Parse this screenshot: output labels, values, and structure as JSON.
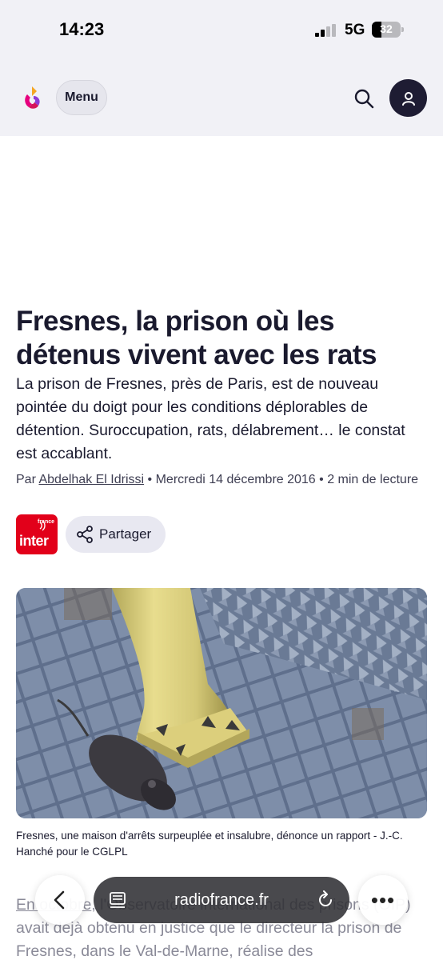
{
  "status_bar": {
    "time": "14:23",
    "network": "5G",
    "battery": "32"
  },
  "header": {
    "menu_label": "Menu",
    "logo_icon": "radiofrance-logo",
    "search_icon": "search-icon",
    "account_icon": "user-icon"
  },
  "article": {
    "title": "Fresnes, la prison où les détenus vivent avec les rats",
    "lead": "La prison de Fresnes, près de Paris, est de nouveau pointée du doigt pour les conditions déplorables de détention. Suroccupation, rats, délabrement… le constat est accablant.",
    "byline": {
      "prefix": "Par",
      "author": "Abdelhak El Idrissi",
      "date": "• Mercredi 14 décembre 2016",
      "reading_time": "• 2 min de lecture"
    },
    "station": {
      "small": "france",
      "name": "inter"
    },
    "share_label": "Partager",
    "caption": "Fresnes, une maison d'arrêts surpeuplée et insalubre, dénonce un rapport - J.-C. Hanché pour le CGLPL",
    "body": {
      "link": "En octobre",
      "text": ", l'Observatoire international des prisons (OIP) avait déjà obtenu en justice que le directeur la prison de Fresnes, dans le Val-de-Marne, réalise des"
    }
  },
  "browser": {
    "url": "radiofrance.fr",
    "back_icon": "chevron-left-icon",
    "reader_icon": "reader-icon",
    "reload_icon": "reload-icon",
    "more_label": "•••"
  },
  "colors": {
    "header_bg": "#f1f1f6",
    "text": "#1a1a2e",
    "account_bg": "#1e1c33",
    "inter_red": "#e2001a",
    "share_bg": "#e8e8f1"
  }
}
